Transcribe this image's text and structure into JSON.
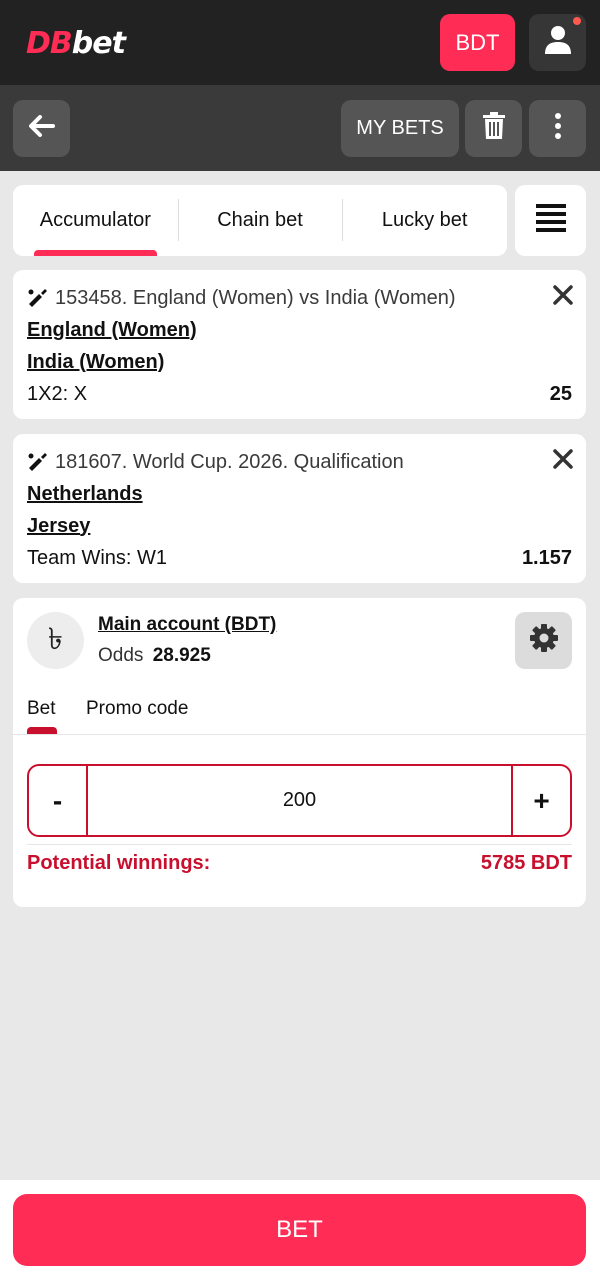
{
  "header": {
    "logo_part1": "DB",
    "logo_part2": "bet",
    "currency_label": "BDT"
  },
  "subheader": {
    "my_bets_label": "MY BETS"
  },
  "tabs": [
    {
      "label": "Accumulator",
      "active": true
    },
    {
      "label": "Chain bet",
      "active": false
    },
    {
      "label": "Lucky bet",
      "active": false
    }
  ],
  "bets": [
    {
      "event": "153458. England (Women) vs India (Women)",
      "team1": "England (Women)",
      "team2": "India (Women)",
      "market": "1X2: X",
      "odd": "25"
    },
    {
      "event": "181607. World Cup. 2026. Qualification",
      "team1": "Netherlands",
      "team2": "Jersey",
      "market": "Team Wins: W1",
      "odd": "1.157"
    }
  ],
  "account": {
    "currency_symbol": "৳",
    "name": "Main account (BDT)",
    "odds_label": "Odds",
    "odds_value": "28.925",
    "tab_bet": "Bet",
    "tab_promo": "Promo code",
    "minus_label": "-",
    "stake_value": "200",
    "plus_label": "+",
    "potential_label": "Potential winnings:",
    "potential_value": "5785 BDT"
  },
  "bottom": {
    "bet_button_label": "BET"
  },
  "colors": {
    "accent": "#ff2d55",
    "dark_accent": "#c8102e",
    "header_bg": "#222222",
    "subheader_bg": "#3a3a3a"
  }
}
